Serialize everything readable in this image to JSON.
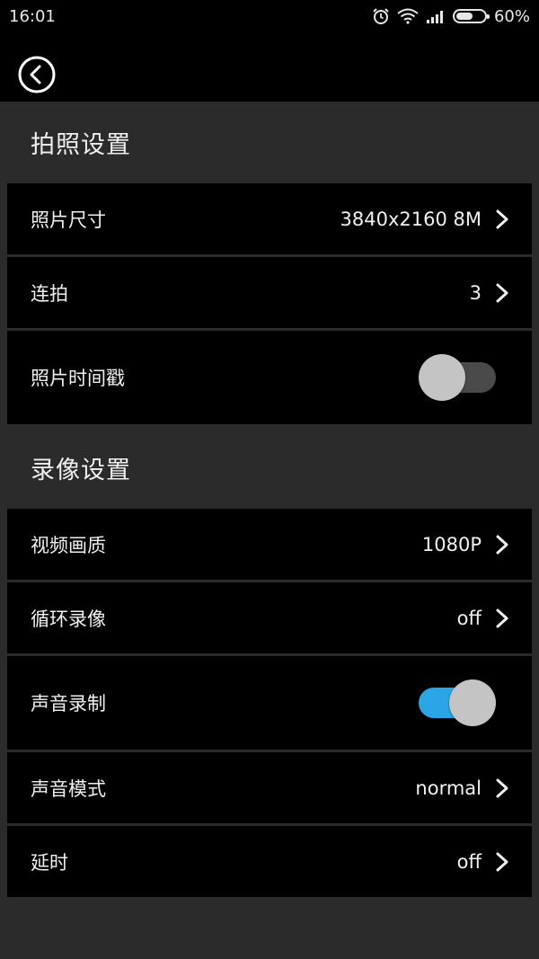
{
  "status_bar": {
    "time": "16:01",
    "battery_text": "60%",
    "battery_level": 0.6,
    "icons": [
      "alarm-icon",
      "wifi-icon",
      "signal-icon",
      "battery-icon"
    ]
  },
  "header": {
    "back_icon": "back-circle-icon"
  },
  "photo_settings": {
    "title": "拍照设置",
    "photo_size": {
      "label": "照片尺寸",
      "value": "3840x2160 8M"
    },
    "burst": {
      "label": "连拍",
      "value": "3"
    },
    "timestamp": {
      "label": "照片时间戳",
      "enabled": false
    }
  },
  "video_settings": {
    "title": "录像设置",
    "video_quality": {
      "label": "视频画质",
      "value": "1080P"
    },
    "loop_recording": {
      "label": "循环录像",
      "value": "off"
    },
    "audio_recording": {
      "label": "声音录制",
      "enabled": true
    },
    "audio_mode": {
      "label": "声音模式",
      "value": "normal"
    },
    "delay": {
      "label": "延时",
      "value": "off"
    }
  },
  "colors": {
    "background": "#2b2b2b",
    "row_background": "#000000",
    "toggle_on": "#2aa6e6",
    "toggle_off": "#4a4a4a",
    "knob": "#c4c4c4"
  }
}
